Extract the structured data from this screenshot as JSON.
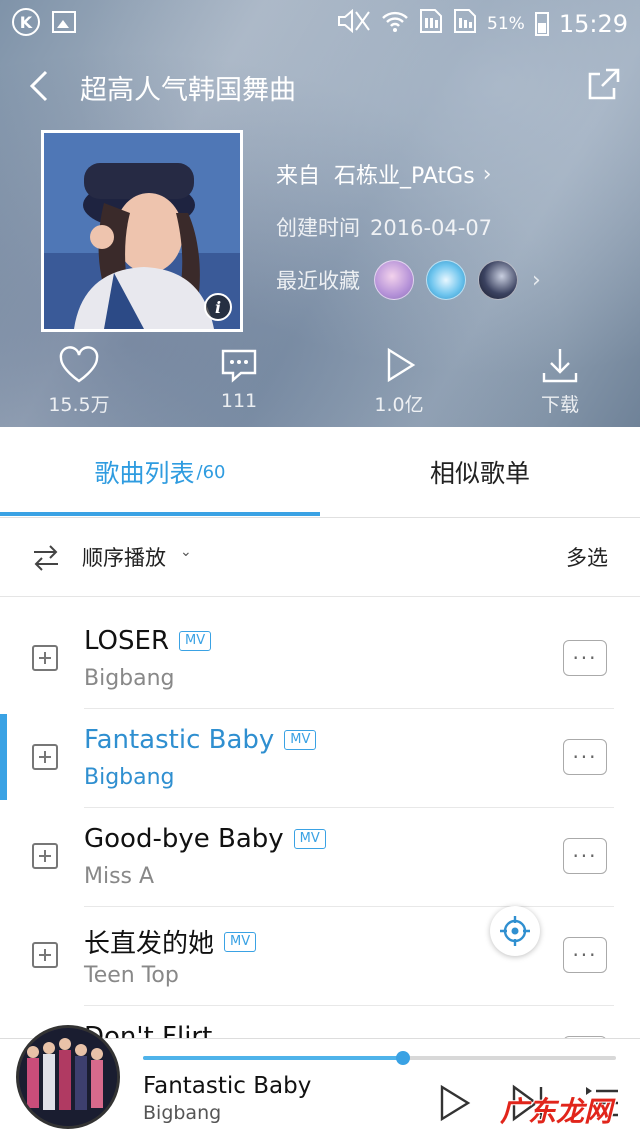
{
  "status_bar": {
    "battery_percent": "51%",
    "time": "15:29",
    "icons": [
      "k-app-icon",
      "gallery-icon",
      "mute-icon",
      "wifi-icon",
      "sim1-icon",
      "sim2-icon",
      "battery-icon"
    ]
  },
  "nav": {
    "title": "超高人气韩国舞曲"
  },
  "playlist": {
    "from_label": "来自",
    "from_user": "石栋业_PAtGs",
    "created_label": "创建时间",
    "created_date": "2016-04-07",
    "recent_label": "最近收藏"
  },
  "actions": {
    "likes": "15.5万",
    "comments": "111",
    "plays": "1.0亿",
    "download": "下载"
  },
  "tabs": {
    "songs_label": "歌曲列表",
    "songs_count": "/60",
    "similar_label": "相似歌单"
  },
  "sort_bar": {
    "mode": "顺序播放",
    "multi_select": "多选"
  },
  "songs": [
    {
      "title": "LOSER",
      "artist": "Bigbang",
      "badge": "MV"
    },
    {
      "title": "Fantastic Baby",
      "artist": "Bigbang",
      "badge": "MV"
    },
    {
      "title": "Good-bye Baby",
      "artist": "Miss A",
      "badge": "MV"
    },
    {
      "title": "长直发的她",
      "artist": "Teen Top",
      "badge": "MV"
    },
    {
      "title": "Don't Flirt",
      "artist": "",
      "badge": ""
    }
  ],
  "active_song_index": 1,
  "player": {
    "title": "Fantastic Baby",
    "artist": "Bigbang",
    "progress": 0.55
  },
  "watermark": "广东龙网",
  "colors": {
    "accent": "#3aa2e4",
    "active_text": "#2f8fd0"
  }
}
